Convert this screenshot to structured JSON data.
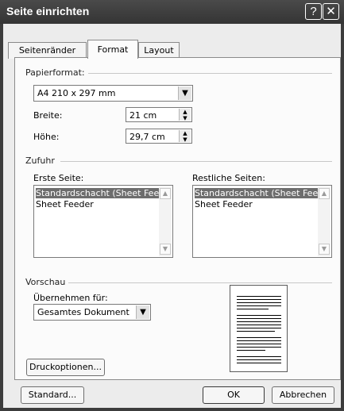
{
  "window": {
    "title": "Seite einrichten",
    "help_glyph": "?",
    "close_glyph": "✕"
  },
  "tabs": [
    {
      "label": "Seitenränder"
    },
    {
      "label": "Format"
    },
    {
      "label": "Layout"
    }
  ],
  "paper": {
    "group_label": "Papierformat:",
    "size_value": "A4 210 x 297 mm",
    "width_label": "Breite:",
    "width_value": "21 cm",
    "height_label": "Höhe:",
    "height_value": "29,7 cm"
  },
  "source": {
    "group_label": "Zufuhr",
    "first_page_label": "Erste Seite:",
    "other_pages_label": "Restliche Seiten:",
    "first_page_items": [
      "Standardschacht (Sheet Fee",
      "Sheet Feeder"
    ],
    "other_pages_items": [
      "Standardschacht (Sheet Fee",
      "Sheet Feeder"
    ]
  },
  "preview": {
    "group_label": "Vorschau",
    "apply_to_label": "Übernehmen für:",
    "apply_to_value": "Gesamtes Dokument"
  },
  "buttons": {
    "print_options": "Druckoptionen...",
    "default": "Standard...",
    "ok": "OK",
    "cancel": "Abbrechen"
  }
}
